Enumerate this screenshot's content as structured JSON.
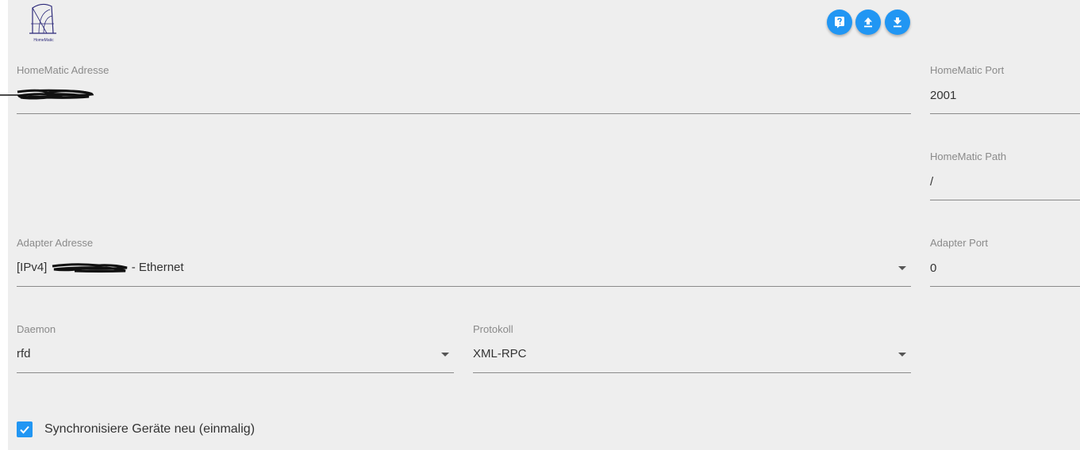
{
  "logo": {
    "brand_text": "HomeMatic",
    "icon": "homematic-logo"
  },
  "toolbar": {
    "buttons": [
      {
        "name": "help-button",
        "icon": "help-icon"
      },
      {
        "name": "upload-button",
        "icon": "upload-icon"
      },
      {
        "name": "download-button",
        "icon": "download-icon"
      }
    ],
    "accent_color": "#2196f3"
  },
  "fields": {
    "homematic_address": {
      "label": "HomeMatic Adresse",
      "value": ""
    },
    "homematic_port": {
      "label": "HomeMatic Port",
      "value": "2001"
    },
    "homematic_path": {
      "label": "HomeMatic Path",
      "value": "/"
    },
    "adapter_address": {
      "label": "Adapter Adresse",
      "value_prefix": "[IPv4]",
      "value_suffix": "- Ethernet"
    },
    "adapter_port": {
      "label": "Adapter Port",
      "value": "0"
    },
    "daemon": {
      "label": "Daemon",
      "value": "rfd"
    },
    "protocol": {
      "label": "Protokoll",
      "value": "XML-RPC"
    }
  },
  "sync_checkbox": {
    "label": "Synchronisiere Geräte neu (einmalig)",
    "checked": true
  }
}
